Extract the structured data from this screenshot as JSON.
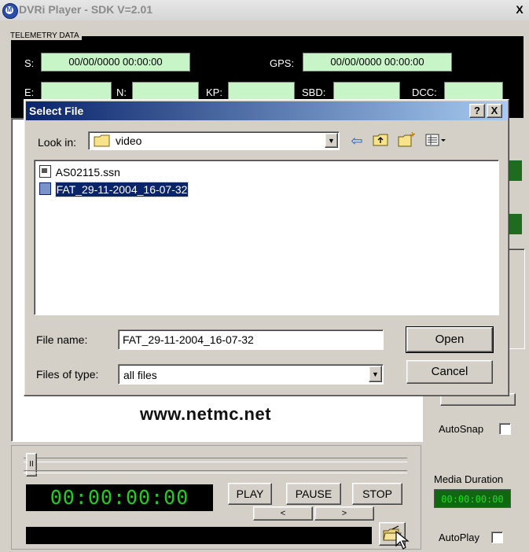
{
  "window": {
    "title": "DVRi Player - SDK V=2.01",
    "close_glyph": "X"
  },
  "telemetry": {
    "group_label": "TELEMETRY DATA",
    "s_label": "S:",
    "s_value": "00/00/0000 00:00:00",
    "gps_label": "GPS:",
    "gps_value": "00/00/0000 00:00:00",
    "e_label": "E:",
    "n_label": "N:",
    "kp_label": "KP:",
    "sbd_label": "SBD:",
    "dcc_label": "DCC:"
  },
  "main": {
    "website": "www.netmc.net",
    "autosnap_label": "AutoSnap",
    "media_duration_label": "Media Duration",
    "media_duration_value": "00:00:00:00",
    "autoplay_label": "AutoPlay",
    "time_display": "00:00:00:00",
    "play_label": "PLAY",
    "pause_label": "PAUSE",
    "stop_label": "STOP",
    "prev_label": "<",
    "next_label": ">",
    "slider_glyph": "II",
    "colors": {
      "display_bg": "#000000",
      "display_fg": "#22cc22",
      "green_field": "#c8f5c8",
      "indicator_green": "#1f6b1f"
    }
  },
  "dialog": {
    "title": "Select File",
    "help_glyph": "?",
    "close_glyph": "X",
    "look_in_label": "Look in:",
    "look_in_value": "video",
    "toolbar_icons": [
      "back-arrow-icon",
      "up-folder-icon",
      "new-folder-icon",
      "view-menu-icon"
    ],
    "files": [
      {
        "name": "AS02115.ssn",
        "icon": "file-icon",
        "selected": false
      },
      {
        "name": "FAT_29-11-2004_16-07-32",
        "icon": "file-icon",
        "selected": true
      }
    ],
    "file_name_label": "File name:",
    "file_name_value": "FAT_29-11-2004_16-07-32",
    "files_of_type_label": "Files of type:",
    "files_of_type_value": "all files",
    "open_label": "Open",
    "cancel_label": "Cancel",
    "colors": {
      "title_start": "#0a246a",
      "title_end": "#a6caf0",
      "selection": "#0a246a"
    }
  }
}
